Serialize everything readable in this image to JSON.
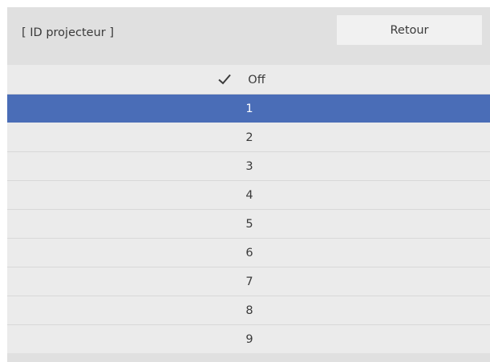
{
  "header": {
    "title": "[ ID projecteur ]",
    "back_label": "Retour"
  },
  "list": {
    "checked_item": "Off",
    "selected_item": "1",
    "items": [
      "Off",
      "1",
      "2",
      "3",
      "4",
      "5",
      "6",
      "7",
      "8",
      "9"
    ]
  },
  "icons": {
    "check": "check-icon"
  },
  "colors": {
    "selection": "#4a6db7",
    "background": "#ebebeb",
    "header": "#e0e0e0"
  }
}
